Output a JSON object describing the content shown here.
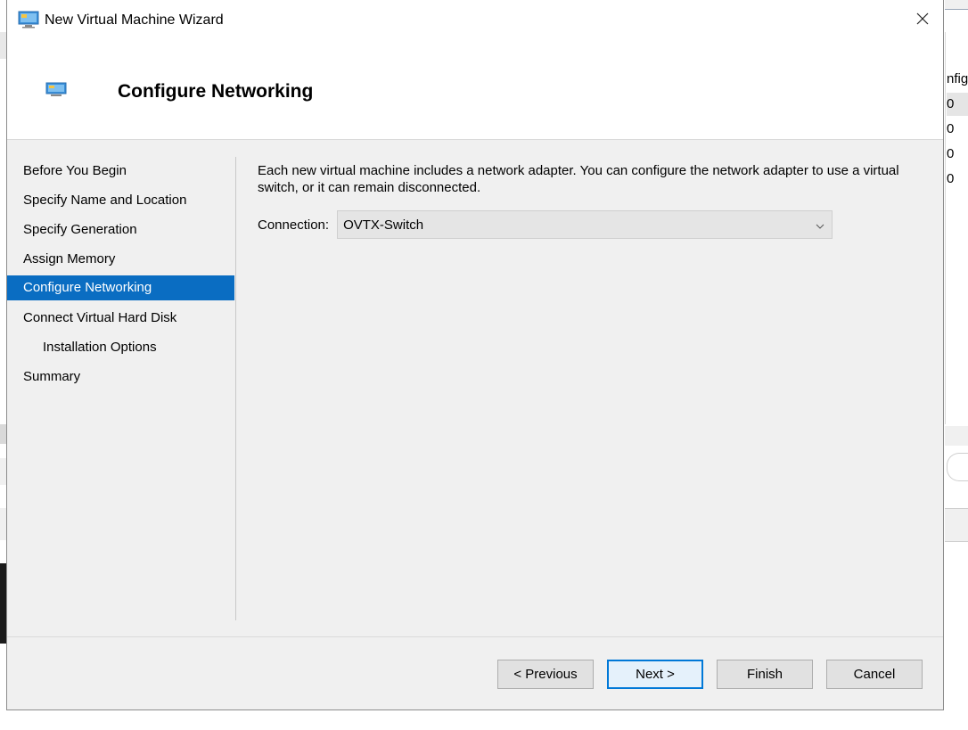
{
  "window": {
    "title": "New Virtual Machine Wizard",
    "icon": "virtual-machine-icon",
    "close_icon": "close-icon"
  },
  "header": {
    "title": "Configure Networking",
    "icon": "virtual-machine-icon"
  },
  "nav": {
    "items": [
      {
        "label": "Before You Begin",
        "active": false,
        "indent": false
      },
      {
        "label": "Specify Name and Location",
        "active": false,
        "indent": false
      },
      {
        "label": "Specify Generation",
        "active": false,
        "indent": false
      },
      {
        "label": "Assign Memory",
        "active": false,
        "indent": false
      },
      {
        "label": "Configure Networking",
        "active": true,
        "indent": false
      },
      {
        "label": "Connect Virtual Hard Disk",
        "active": false,
        "indent": false
      },
      {
        "label": "Installation Options",
        "active": false,
        "indent": true
      },
      {
        "label": "Summary",
        "active": false,
        "indent": false
      }
    ]
  },
  "main": {
    "description": "Each new virtual machine includes a network adapter. You can configure the network adapter to use a virtual switch, or it can remain disconnected.",
    "connection_label": "Connection:",
    "connection_value": "OVTX-Switch",
    "dropdown_icon": "chevron-down-icon"
  },
  "buttons": {
    "previous": "< Previous",
    "next": "Next >",
    "finish": "Finish",
    "cancel": "Cancel"
  },
  "background": {
    "right_header_fragment": "nfig",
    "right_row_fragments": [
      "0",
      "0",
      "0",
      "0"
    ]
  },
  "colors": {
    "accent": "#0a6dc2",
    "default_button_border": "#0078d7",
    "window_bg": "#f0f0f0"
  }
}
